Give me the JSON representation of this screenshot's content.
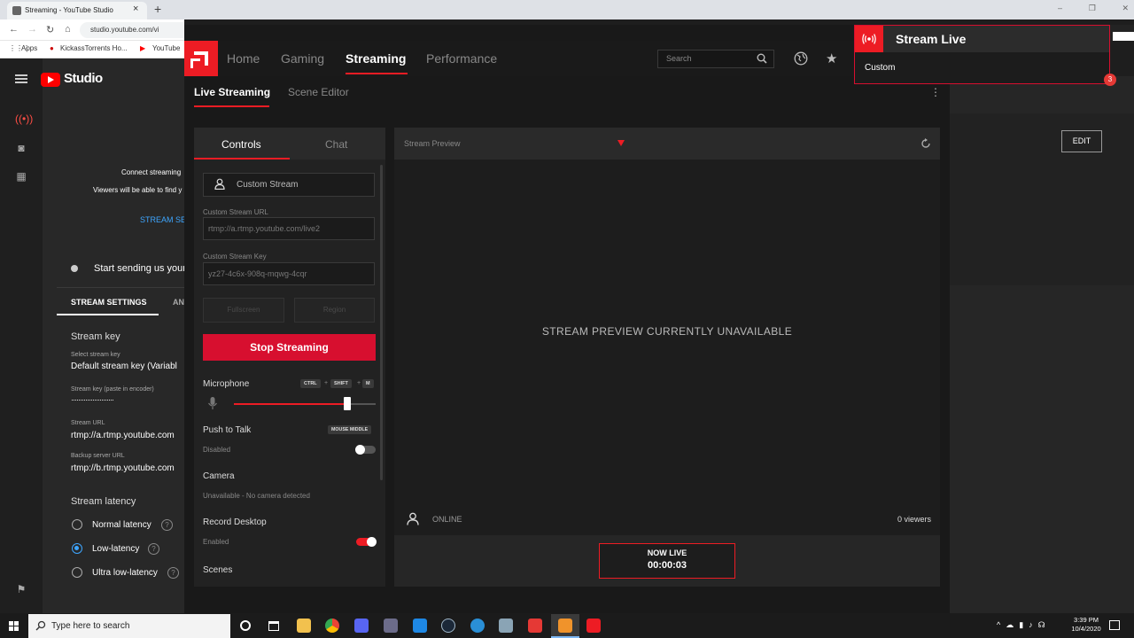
{
  "browser": {
    "tab_title": "Streaming - YouTube Studio",
    "tab_close": "×",
    "new_tab": "+",
    "url": "studio.youtube.com/vi",
    "bookmarks": [
      "Apps",
      "KickassTorrents Ho...",
      "YouTube"
    ]
  },
  "yt": {
    "logo": "Studio",
    "connect_text": "Connect streaming",
    "viewers_text": "Viewers will be able to find y",
    "stream_setup": "STREAM SE",
    "start_text": "Start sending us your",
    "tab_settings": "STREAM SETTINGS",
    "tab_analytics": "AN",
    "stream_key_heading": "Stream key",
    "select_key_label": "Select stream key",
    "select_key_value": "Default stream key (Variabl",
    "key_label": "Stream key (paste in encoder)",
    "key_value": "························",
    "url_label": "Stream URL",
    "url_value": "rtmp://a.rtmp.youtube.com",
    "backup_label": "Backup server URL",
    "backup_value": "rtmp://b.rtmp.youtube.com",
    "latency_heading": "Stream latency",
    "latency_options": [
      "Normal latency",
      "Low-latency",
      "Ultra low-latency"
    ],
    "edit_label": "EDIT"
  },
  "amd": {
    "nav": [
      "Home",
      "Gaming",
      "Streaming",
      "Performance"
    ],
    "search_placeholder": "Search",
    "subnav": [
      "Live Streaming",
      "Scene Editor"
    ],
    "panel_tabs": [
      "Controls",
      "Chat"
    ],
    "service": "Custom Stream",
    "url_label": "Custom Stream URL",
    "url_value": "rtmp://a.rtmp.youtube.com/live2",
    "key_label": "Custom Stream Key",
    "key_value": "yz27-4c6x-908q-mqwg-4cqr",
    "fullscreen": "Fullscreen",
    "region": "Region",
    "stop": "Stop Streaming",
    "mic_title": "Microphone",
    "mic_keys": [
      "CTRL",
      "+",
      "SHIFT",
      "+",
      "M"
    ],
    "mic_level": 0.8,
    "ptt_title": "Push to Talk",
    "ptt_key": "MOUSE MIDDLE",
    "ptt_state": "Disabled",
    "camera_title": "Camera",
    "camera_state": "Unavailable - No camera detected",
    "record_title": "Record Desktop",
    "record_state": "Enabled",
    "scenes_title": "Scenes",
    "preview_title": "Stream Preview",
    "preview_unavailable": "STREAM PREVIEW CURRENTLY UNAVAILABLE",
    "online": "ONLINE",
    "viewers": "0 viewers",
    "now_live": "NOW LIVE",
    "timer": "00:00:03"
  },
  "toast": {
    "title": "Stream Live",
    "body": "Custom"
  },
  "taskbar": {
    "search": "Type here to search",
    "time": "3:39 PM",
    "date": "10/4/2020"
  },
  "colors": {
    "amd_red": "#ed1c24",
    "yt_blue": "#3ea6ff"
  }
}
